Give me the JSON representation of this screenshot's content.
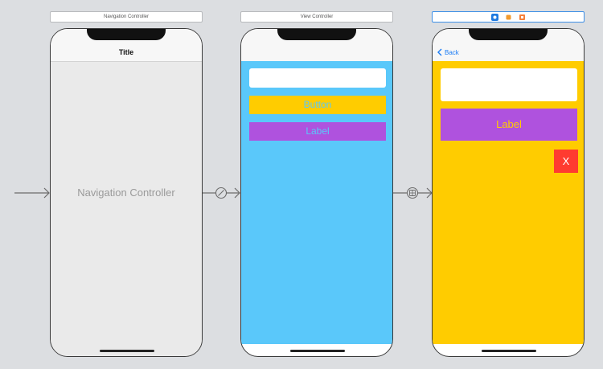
{
  "colors": {
    "canvas": "#dcdee1",
    "vc_background": "#5ac8fa",
    "detail_background": "#ffcc00",
    "yellow_button": "#ffcc00",
    "purple_label": "#af52de",
    "red_button": "#ff3b30",
    "link_blue": "#1a7cf5",
    "navctrl_text": "#9a9a9a"
  },
  "scene1": {
    "header": "Navigation Controller",
    "nav_title": "Title",
    "body_label": "Navigation Controller"
  },
  "scene2": {
    "header": "View Controller",
    "text_field_value": "",
    "button_label": "Button",
    "label_text": "Label"
  },
  "scene3": {
    "header_icons": [
      "view-controller-icon",
      "first-responder-icon",
      "exit-icon"
    ],
    "back_label": "Back",
    "text_field_value": "",
    "label_text": "Label",
    "close_button_label": "X"
  },
  "segues": [
    {
      "name": "entry-point-arrow",
      "icon": "none"
    },
    {
      "name": "root-relationship-segue",
      "icon": "relationship-icon"
    },
    {
      "name": "show-segue",
      "icon": "push-segue-icon"
    }
  ]
}
